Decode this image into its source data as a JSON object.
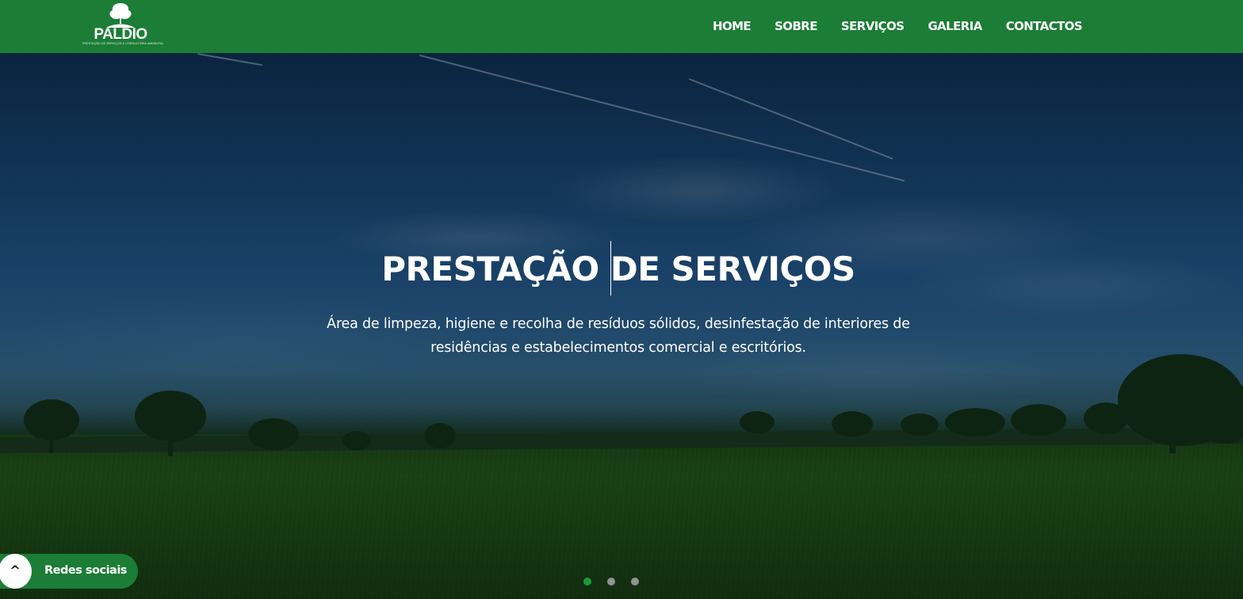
{
  "brand": {
    "name": "PALDIO",
    "tagline": "PRESTAÇÃO DE SERVIÇOS & CONSULTORIA AMBIENTAL"
  },
  "nav": {
    "items": [
      {
        "label": "HOME"
      },
      {
        "label": "SOBRE"
      },
      {
        "label": "SERVIÇOS"
      },
      {
        "label": "GALERIA"
      },
      {
        "label": "CONTACTOS"
      }
    ]
  },
  "hero": {
    "title": "PRESTAÇÃO DE SERVIÇOS",
    "description": "Área de limpeza, higiene e recolha de resíduos sólidos, desinfestação de interiores de residências e estabelecimentos comercial e escritórios."
  },
  "carousel": {
    "slide_count": 3,
    "active_index": 0
  },
  "social": {
    "toggle_icon": "^",
    "label": "Redes sociais"
  },
  "colors": {
    "brand_green": "#1b7d36",
    "active_dot": "#1b9a3e",
    "inactive_dot": "#8e9490"
  },
  "icons": [
    "tree-logo-icon",
    "chevron-up-icon"
  ]
}
